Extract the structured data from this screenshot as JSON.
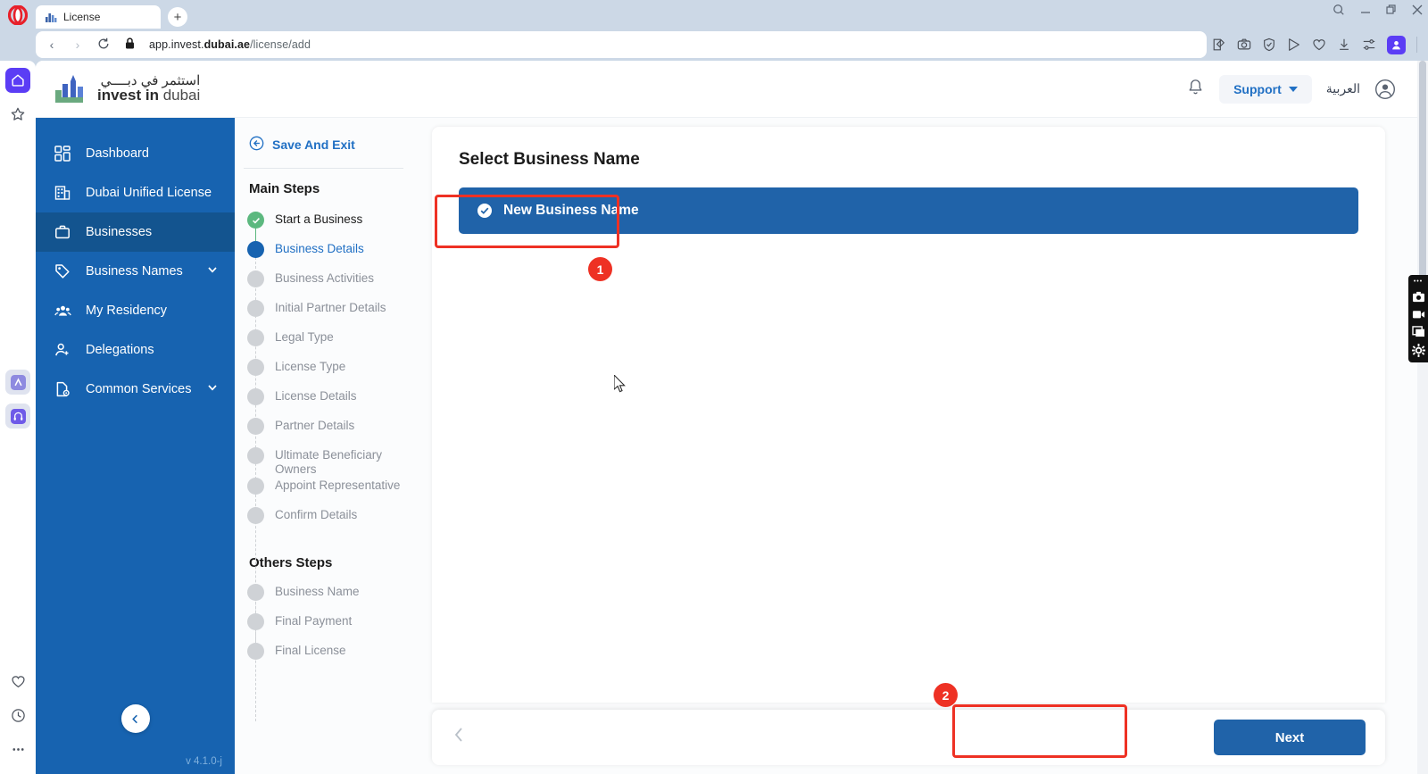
{
  "browser": {
    "tab": {
      "title": "License",
      "favicon": "chart-icon"
    },
    "new_tab_label": "+",
    "window_controls": [
      "search-icon",
      "minimize-icon",
      "maximize-icon",
      "close-icon"
    ],
    "nav": {
      "back": "‹",
      "forward": "›",
      "reload": "⟳"
    },
    "address": {
      "lock": "lock-icon",
      "prefix": "app.invest.",
      "domain": "dubai.ae",
      "path": "/license/add"
    },
    "toolbar_icons": [
      "notes-icon",
      "snapshot-icon",
      "shield-icon",
      "send-icon",
      "heart-icon",
      "download-icon",
      "easy-setup-icon"
    ],
    "profile_icon": "profile-icon",
    "rail_icons": [
      "home-icon",
      "bookmarks-star-icon",
      "app-one-icon",
      "headphones-icon",
      "heart-icon",
      "history-clock-icon",
      "more-dots-icon"
    ]
  },
  "header": {
    "logo_arabic": "استثمر في دبــــي",
    "logo_bold": "invest in",
    "logo_light": " dubai",
    "bell_icon": "notification-bell-icon",
    "support_label": "Support",
    "language_label": "العربية",
    "avatar_icon": "user-avatar-icon"
  },
  "sidebar": {
    "items": [
      {
        "label": "Dashboard",
        "icon": "grid-dashboard-icon",
        "active": false,
        "chevron": false
      },
      {
        "label": "Dubai Unified License",
        "icon": "building-icon",
        "active": false,
        "chevron": false
      },
      {
        "label": "Businesses",
        "icon": "briefcase-icon",
        "active": true,
        "chevron": false
      },
      {
        "label": "Business Names",
        "icon": "tag-icon",
        "active": false,
        "chevron": true
      },
      {
        "label": "My Residency",
        "icon": "people-icon",
        "active": false,
        "chevron": false
      },
      {
        "label": "Delegations",
        "icon": "user-add-icon",
        "active": false,
        "chevron": false
      },
      {
        "label": "Common Services",
        "icon": "document-settings-icon",
        "active": false,
        "chevron": true
      }
    ],
    "collapse_icon": "chevron-left-icon",
    "version": "v 4.1.0-j"
  },
  "steps_panel": {
    "save_and_exit": "Save And Exit",
    "save_and_exit_icon": "arrow-left-circle-icon",
    "main_steps_title": "Main Steps",
    "main_steps": [
      {
        "label": "Start a Business",
        "state": "done"
      },
      {
        "label": "Business Details",
        "state": "current"
      },
      {
        "label": "Business Activities",
        "state": "pending"
      },
      {
        "label": "Initial Partner Details",
        "state": "pending"
      },
      {
        "label": "Legal Type",
        "state": "pending"
      },
      {
        "label": "License Type",
        "state": "pending"
      },
      {
        "label": "License Details",
        "state": "pending"
      },
      {
        "label": "Partner Details",
        "state": "pending"
      },
      {
        "label": "Ultimate Beneficiary Owners",
        "state": "pending"
      },
      {
        "label": "Appoint Representative",
        "state": "pending"
      },
      {
        "label": "Confirm Details",
        "state": "pending"
      }
    ],
    "others_steps_title": "Others Steps",
    "others_steps": [
      {
        "label": "Business Name",
        "state": "pending"
      },
      {
        "label": "Final Payment",
        "state": "pending"
      },
      {
        "label": "Final License",
        "state": "pending"
      }
    ]
  },
  "main": {
    "title": "Select Business Name",
    "option": {
      "label": "New Business Name",
      "icon": "check-circle-icon",
      "selected": true
    },
    "footer": {
      "back_icon": "chevron-left-icon",
      "next_label": "Next"
    }
  },
  "annotations": [
    {
      "number": "1",
      "target": "new-business-name-option"
    },
    {
      "number": "2",
      "target": "next-button"
    }
  ],
  "capture_toolbar": {
    "icons": [
      "camera-icon",
      "video-icon",
      "window-icon",
      "gear-icon"
    ]
  },
  "colors": {
    "brand_blue": "#1763b0",
    "sidebar_active": "#13548f",
    "button_blue": "#2063a9",
    "annotation_red": "#ee3124",
    "link_blue": "#2170c4",
    "step_done_green": "#5cb87f",
    "opera_purple": "#5b3df5"
  }
}
